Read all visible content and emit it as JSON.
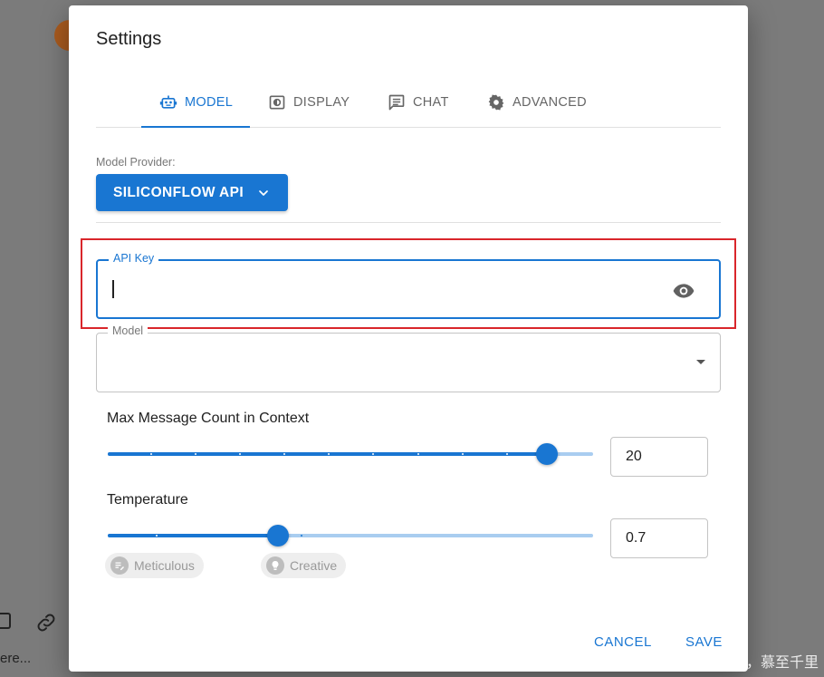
{
  "background": {
    "partial_text": "ere..."
  },
  "watermark": "CSDN @积跬步，慕至千里",
  "dialog": {
    "title": "Settings",
    "tabs": [
      {
        "label": "MODEL",
        "icon": "robot-icon",
        "active": true
      },
      {
        "label": "DISPLAY",
        "icon": "display-icon",
        "active": false
      },
      {
        "label": "CHAT",
        "icon": "chat-icon",
        "active": false
      },
      {
        "label": "ADVANCED",
        "icon": "gear-icon",
        "active": false
      }
    ],
    "model_provider": {
      "label": "Model Provider:",
      "value": "SILICONFLOW API"
    },
    "api_key": {
      "label": "API Key",
      "value": ""
    },
    "model": {
      "label": "Model",
      "value": ""
    },
    "max_message_count": {
      "label": "Max Message Count in Context",
      "value": "20",
      "slider_fraction": 0.905,
      "marks": 11
    },
    "temperature": {
      "label": "Temperature",
      "value": "0.7",
      "slider_fraction": 0.35,
      "chips": [
        "Meticulous",
        "Creative"
      ]
    },
    "actions": {
      "cancel": "CANCEL",
      "save": "SAVE"
    }
  },
  "colors": {
    "primary": "#1976d2",
    "highlight_box": "#d9262b",
    "overlay": "#7b7b7b"
  }
}
